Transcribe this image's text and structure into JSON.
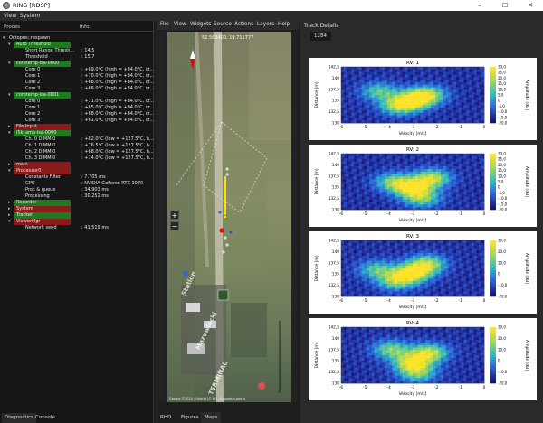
{
  "window": {
    "title": "RING [RDSP]"
  },
  "main_menu": [
    "View",
    "System"
  ],
  "left_panel": {
    "col_process": "Proces",
    "col_info": "info",
    "tree": [
      {
        "label": "Octopus::respawn",
        "value": "",
        "indent": 0,
        "style": "plain",
        "arrow": "▾"
      },
      {
        "label": "Auto Threshold",
        "value": "",
        "indent": 1,
        "style": "green",
        "arrow": "▾"
      },
      {
        "label": "Short Range Thresh...",
        "value": ": 14.5",
        "indent": 2,
        "style": "plain",
        "arrow": ""
      },
      {
        "label": "Threshold",
        "value": ": 15.7",
        "indent": 2,
        "style": "plain",
        "arrow": ""
      },
      {
        "label": "coretemp-isa-0000",
        "value": "",
        "indent": 1,
        "style": "green",
        "arrow": "▾"
      },
      {
        "label": "Core 0",
        "value": ": +69.0°C  (high = +84.0°C, cr...",
        "indent": 2,
        "style": "plain",
        "arrow": ""
      },
      {
        "label": "Core 1",
        "value": ": +70.0°C  (high = +84.0°C, cr...",
        "indent": 2,
        "style": "plain",
        "arrow": ""
      },
      {
        "label": "Core 2",
        "value": ": +68.0°C  (high = +84.0°C, cr...",
        "indent": 2,
        "style": "plain",
        "arrow": ""
      },
      {
        "label": "Core 3",
        "value": ": +66.0°C  (high = +84.0°C, cr...",
        "indent": 2,
        "style": "plain",
        "arrow": ""
      },
      {
        "label": "coretemp-isa-0001",
        "value": "",
        "indent": 1,
        "style": "green",
        "arrow": "▾"
      },
      {
        "label": "Core 0",
        "value": ": +71.0°C  (high = +84.0°C, cr...",
        "indent": 2,
        "style": "plain",
        "arrow": ""
      },
      {
        "label": "Core 1",
        "value": ": +65.0°C  (high = +84.0°C, cr...",
        "indent": 2,
        "style": "plain",
        "arrow": ""
      },
      {
        "label": "Core 2",
        "value": ": +68.0°C  (high = +84.0°C, cr...",
        "indent": 2,
        "style": "plain",
        "arrow": ""
      },
      {
        "label": "Core 3",
        "value": ": +61.0°C  (high = +84.0°C, cr...",
        "indent": 2,
        "style": "plain",
        "arrow": ""
      },
      {
        "label": "File Input",
        "value": "",
        "indent": 1,
        "style": "red",
        "arrow": "▸"
      },
      {
        "label": "i5k_amb-isa-0000",
        "value": "",
        "indent": 1,
        "style": "green",
        "arrow": "▾"
      },
      {
        "label": "Ch. 0 DIMM 0",
        "value": ": +82.0°C  (low = +127.5°C, h...",
        "indent": 2,
        "style": "plain",
        "arrow": ""
      },
      {
        "label": "Ch. 1 DIMM 0",
        "value": ": +76.5°C  (low = +127.5°C, h...",
        "indent": 2,
        "style": "plain",
        "arrow": ""
      },
      {
        "label": "Ch. 2 DIMM 0",
        "value": ": +68.0°C  (low = +127.5°C, h...",
        "indent": 2,
        "style": "plain",
        "arrow": ""
      },
      {
        "label": "Ch. 3 DIMM 0",
        "value": ": +74.0°C  (low = +127.5°C, h...",
        "indent": 2,
        "style": "plain",
        "arrow": ""
      },
      {
        "label": "main",
        "value": "",
        "indent": 1,
        "style": "red",
        "arrow": "▸"
      },
      {
        "label": "Processor0",
        "value": "",
        "indent": 1,
        "style": "red",
        "arrow": "▾"
      },
      {
        "label": "Constants Filter",
        "value": ": 7.705 ms",
        "indent": 2,
        "style": "plain",
        "arrow": ""
      },
      {
        "label": "GPU",
        "value": ": NVIDIA GeForce RTX 3070",
        "indent": 2,
        "style": "plain",
        "arrow": ""
      },
      {
        "label": "Proc & queue",
        "value": ": 34.903 ms",
        "indent": 2,
        "style": "plain",
        "arrow": ""
      },
      {
        "label": "Processing",
        "value": ": 30.252 ms",
        "indent": 2,
        "style": "plain",
        "arrow": ""
      },
      {
        "label": "Recorder",
        "value": "",
        "indent": 1,
        "style": "green",
        "arrow": "▸"
      },
      {
        "label": "System",
        "value": "",
        "indent": 1,
        "style": "red",
        "arrow": "▸"
      },
      {
        "label": "Tracker",
        "value": "",
        "indent": 1,
        "style": "green",
        "arrow": "▸"
      },
      {
        "label": "ViewerMgr",
        "value": "",
        "indent": 1,
        "style": "red",
        "arrow": "▾"
      },
      {
        "label": "Network send",
        "value": ": 41.519 ms",
        "indent": 2,
        "style": "plain",
        "arrow": ""
      }
    ],
    "bottom_tabs": [
      "Diagnostics",
      "Console"
    ]
  },
  "mid_panel": {
    "menu": [
      "File",
      "View",
      "Widgets",
      "Source",
      "Actions",
      "Layers",
      "Help"
    ],
    "coords": "52.563400, 19.711777",
    "zoom_in": "+",
    "zoom_out": "−",
    "watermark1": "Station",
    "watermark2": "Mazowiecki",
    "watermark3": "TERMINAL",
    "attribution": "Google ©2024 · Hybrid (© PL), Geoportal.gov.pl",
    "bottom_tabs": [
      "RHD",
      "Figures",
      "Maps"
    ]
  },
  "right_panel": {
    "title": "Track Details",
    "tab": "1284"
  },
  "colors": {
    "green_badge": "#1e7a1e",
    "red_badge": "#8b1a1a",
    "track": "#ffe000"
  },
  "chart_data": [
    {
      "type": "heatmap",
      "title": "RV: 1",
      "xlabel": "Velocity [m/s]",
      "ylabel": "Distance [m]",
      "colorbar_label": "Amplitude [dB]",
      "x_ticks": [
        "-6",
        "-5",
        "-4",
        "-3",
        "-2",
        "-1",
        "0"
      ],
      "y_ticks": [
        "142,5",
        "140",
        "137,5",
        "135",
        "132,5",
        "130"
      ],
      "colorbar_ticks": [
        "30,0",
        "25,0",
        "20,0",
        "15,0",
        "10,0",
        "5,0",
        "0",
        "-5,0",
        "-10,0",
        "-15,0",
        "-20,0"
      ],
      "xlim": [
        -6,
        0
      ],
      "ylim": [
        130,
        142.5
      ],
      "hotspots": [
        {
          "x": -3.0,
          "y": 135.0,
          "v": 24
        },
        {
          "x": -2.4,
          "y": 136.2,
          "v": 20
        },
        {
          "x": -3.6,
          "y": 133.8,
          "v": 16
        },
        {
          "x": -4.4,
          "y": 137.0,
          "v": 10
        }
      ]
    },
    {
      "type": "heatmap",
      "title": "RV: 2",
      "xlabel": "Velocity [m/s]",
      "ylabel": "Distance [m]",
      "colorbar_label": "Amplitude [dB]",
      "x_ticks": [
        "-6",
        "-5",
        "-4",
        "-3",
        "-2",
        "-1",
        "0"
      ],
      "y_ticks": [
        "142,5",
        "140",
        "137,5",
        "135",
        "132,5",
        "130"
      ],
      "colorbar_ticks": [
        "30,0",
        "25,0",
        "20,0",
        "15,0",
        "10,0",
        "5,0",
        "0",
        "-5,0",
        "-10,0",
        "-15,0",
        "-20,0"
      ],
      "xlim": [
        -6,
        0
      ],
      "ylim": [
        130,
        142.5
      ],
      "hotspots": [
        {
          "x": -3.0,
          "y": 134.8,
          "v": 26
        },
        {
          "x": -2.2,
          "y": 137.0,
          "v": 22
        },
        {
          "x": -3.8,
          "y": 136.2,
          "v": 14
        },
        {
          "x": -2.6,
          "y": 132.5,
          "v": 12
        }
      ]
    },
    {
      "type": "heatmap",
      "title": "RV: 3",
      "xlabel": "Velocity [m/s]",
      "ylabel": "Distance [m]",
      "colorbar_label": "Amplitude [dB]",
      "x_ticks": [
        "-6",
        "-5",
        "-4",
        "-3",
        "-2",
        "-1",
        "0"
      ],
      "y_ticks": [
        "142,5",
        "140",
        "137,5",
        "135",
        "132,5",
        "130"
      ],
      "colorbar_ticks": [
        "30,0",
        "20,0",
        "10,0",
        "0",
        "-10,0",
        "-20,0"
      ],
      "xlim": [
        -6,
        0
      ],
      "ylim": [
        130,
        142.5
      ],
      "hotspots": [
        {
          "x": -3.0,
          "y": 135.2,
          "v": 28
        },
        {
          "x": -2.4,
          "y": 137.2,
          "v": 20
        },
        {
          "x": -3.7,
          "y": 133.5,
          "v": 16
        },
        {
          "x": -4.5,
          "y": 136.0,
          "v": 10
        }
      ]
    },
    {
      "type": "heatmap",
      "title": "RV: 4",
      "xlabel": "Velocity [m/s]",
      "ylabel": "Distance [m]",
      "colorbar_label": "Amplitude [dB]",
      "x_ticks": [
        "-6",
        "-5",
        "-4",
        "-3",
        "-2",
        "-1",
        "0"
      ],
      "y_ticks": [
        "142,5",
        "140",
        "137,5",
        "135",
        "132,5",
        "130"
      ],
      "colorbar_ticks": [
        "30,0",
        "20,0",
        "10,0",
        "0",
        "-10,0",
        "-20,0"
      ],
      "xlim": [
        -6,
        0
      ],
      "ylim": [
        130,
        142.5
      ],
      "hotspots": [
        {
          "x": -3.0,
          "y": 134.6,
          "v": 26
        },
        {
          "x": -2.3,
          "y": 136.8,
          "v": 22
        },
        {
          "x": -3.9,
          "y": 137.5,
          "v": 14
        },
        {
          "x": -2.8,
          "y": 132.2,
          "v": 12
        }
      ]
    }
  ]
}
